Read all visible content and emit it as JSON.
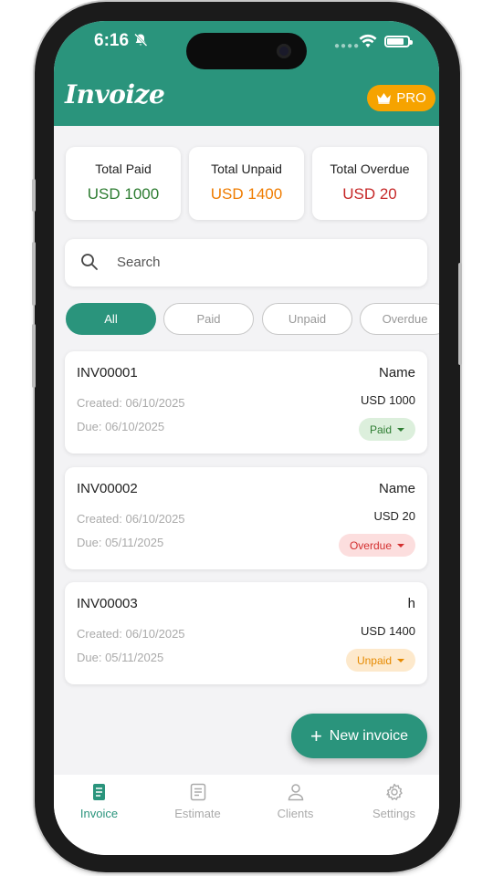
{
  "status_bar": {
    "time": "6:16"
  },
  "app": {
    "logo": "Invoize",
    "pro_label": "PRO"
  },
  "summary": [
    {
      "label": "Total Paid",
      "value": "USD 1000",
      "color": "#2e7d32"
    },
    {
      "label": "Total Unpaid",
      "value": "USD 1400",
      "color": "#ef7c00"
    },
    {
      "label": "Total Overdue",
      "value": "USD 20",
      "color": "#c62828"
    }
  ],
  "search": {
    "placeholder": "Search"
  },
  "filters": [
    "All",
    "Paid",
    "Unpaid",
    "Overdue"
  ],
  "invoices": [
    {
      "number": "INV00001",
      "created": "Created: 06/10/2025",
      "due": "Due: 06/10/2025",
      "client": "Name",
      "amount": "USD 1000",
      "status": "Paid"
    },
    {
      "number": "INV00002",
      "created": "Created: 06/10/2025",
      "due": "Due: 05/11/2025",
      "client": "Name",
      "amount": "USD 20",
      "status": "Overdue"
    },
    {
      "number": "INV00003",
      "created": "Created: 06/10/2025",
      "due": "Due: 05/11/2025",
      "client": "h",
      "amount": "USD 1400",
      "status": "Unpaid"
    }
  ],
  "status_colors": {
    "Paid": {
      "bg": "#dcefdc",
      "fg": "#2e7d32"
    },
    "Overdue": {
      "bg": "#fcdede",
      "fg": "#d32f2f"
    },
    "Unpaid": {
      "bg": "#fde9cc",
      "fg": "#e68a00"
    }
  },
  "fab": {
    "label": "New invoice"
  },
  "tabs": [
    {
      "label": "Invoice",
      "icon": "invoice-icon"
    },
    {
      "label": "Estimate",
      "icon": "estimate-icon"
    },
    {
      "label": "Clients",
      "icon": "person-icon"
    },
    {
      "label": "Settings",
      "icon": "gear-icon"
    }
  ],
  "colors": {
    "primary": "#2a947c",
    "pro": "#f6a300"
  }
}
